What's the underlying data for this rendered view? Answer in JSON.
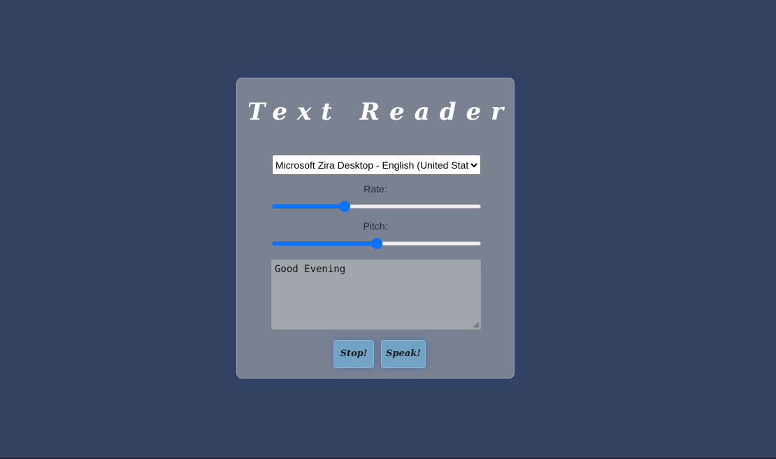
{
  "app": {
    "title": "Text Reader"
  },
  "voice_select": {
    "selected": "Microsoft Zira Desktop - English (United States)",
    "icon": "chevron-down-icon"
  },
  "rate": {
    "label": "Rate:",
    "value_fraction": 0.34
  },
  "pitch": {
    "label": "Pitch:",
    "value_fraction": 0.5
  },
  "text_input": {
    "value": "Good Evening"
  },
  "buttons": {
    "stop_label": "Stop!",
    "speak_label": "Speak!"
  },
  "colors": {
    "page_background": "#334360",
    "card_background": "#7a8292",
    "slider_accent": "#0d73f5",
    "button_background": "#71a3c5"
  }
}
